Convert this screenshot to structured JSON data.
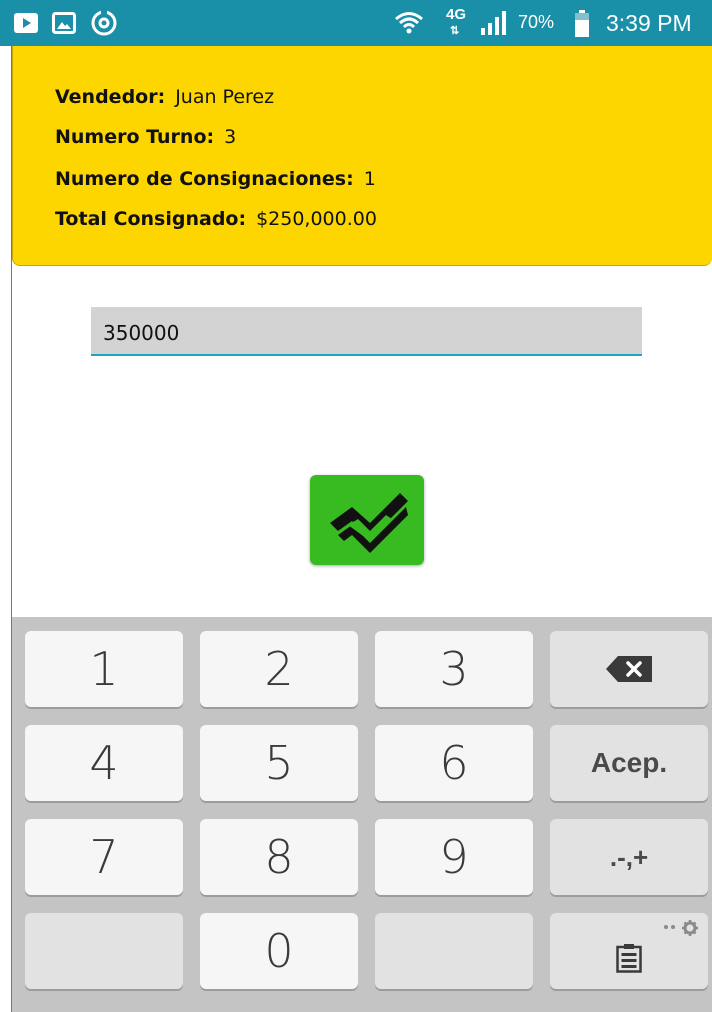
{
  "status_bar": {
    "time": "3:39 PM",
    "battery": "70%",
    "network": "4G",
    "icons": [
      "video-notification-icon",
      "image-notification-icon",
      "sync-notification-icon",
      "wifi-icon",
      "signal-icon",
      "battery-icon"
    ]
  },
  "info": {
    "vendedor_label": "Vendedor:",
    "vendedor_value": "Juan Perez",
    "turno_label": "Numero Turno:",
    "turno_value": "3",
    "consignaciones_label": "Numero de Consignaciones:",
    "consignaciones_value": "1",
    "total_label": "Total Consignado:",
    "total_value": "$250,000.00"
  },
  "amount_input": {
    "value": "350000"
  },
  "confirm_button": {
    "icon": "check-icon"
  },
  "keyboard": {
    "keys": {
      "k1": "1",
      "k2": "2",
      "k3": "3",
      "k4": "4",
      "k5": "5",
      "k6": "6",
      "k7": "7",
      "k8": "8",
      "k9": "9",
      "k0": "0",
      "accept": "Acep.",
      "symbols": ".-,+"
    },
    "icons": [
      "backspace-icon",
      "clipboard-icon",
      "settings-icon"
    ]
  },
  "colors": {
    "status_bar": "#1a8fa8",
    "info_card": "#fdd600",
    "input_underline": "#1ea3c2",
    "confirm_button": "#38bb21",
    "keyboard_bg": "#c4c4c4"
  }
}
